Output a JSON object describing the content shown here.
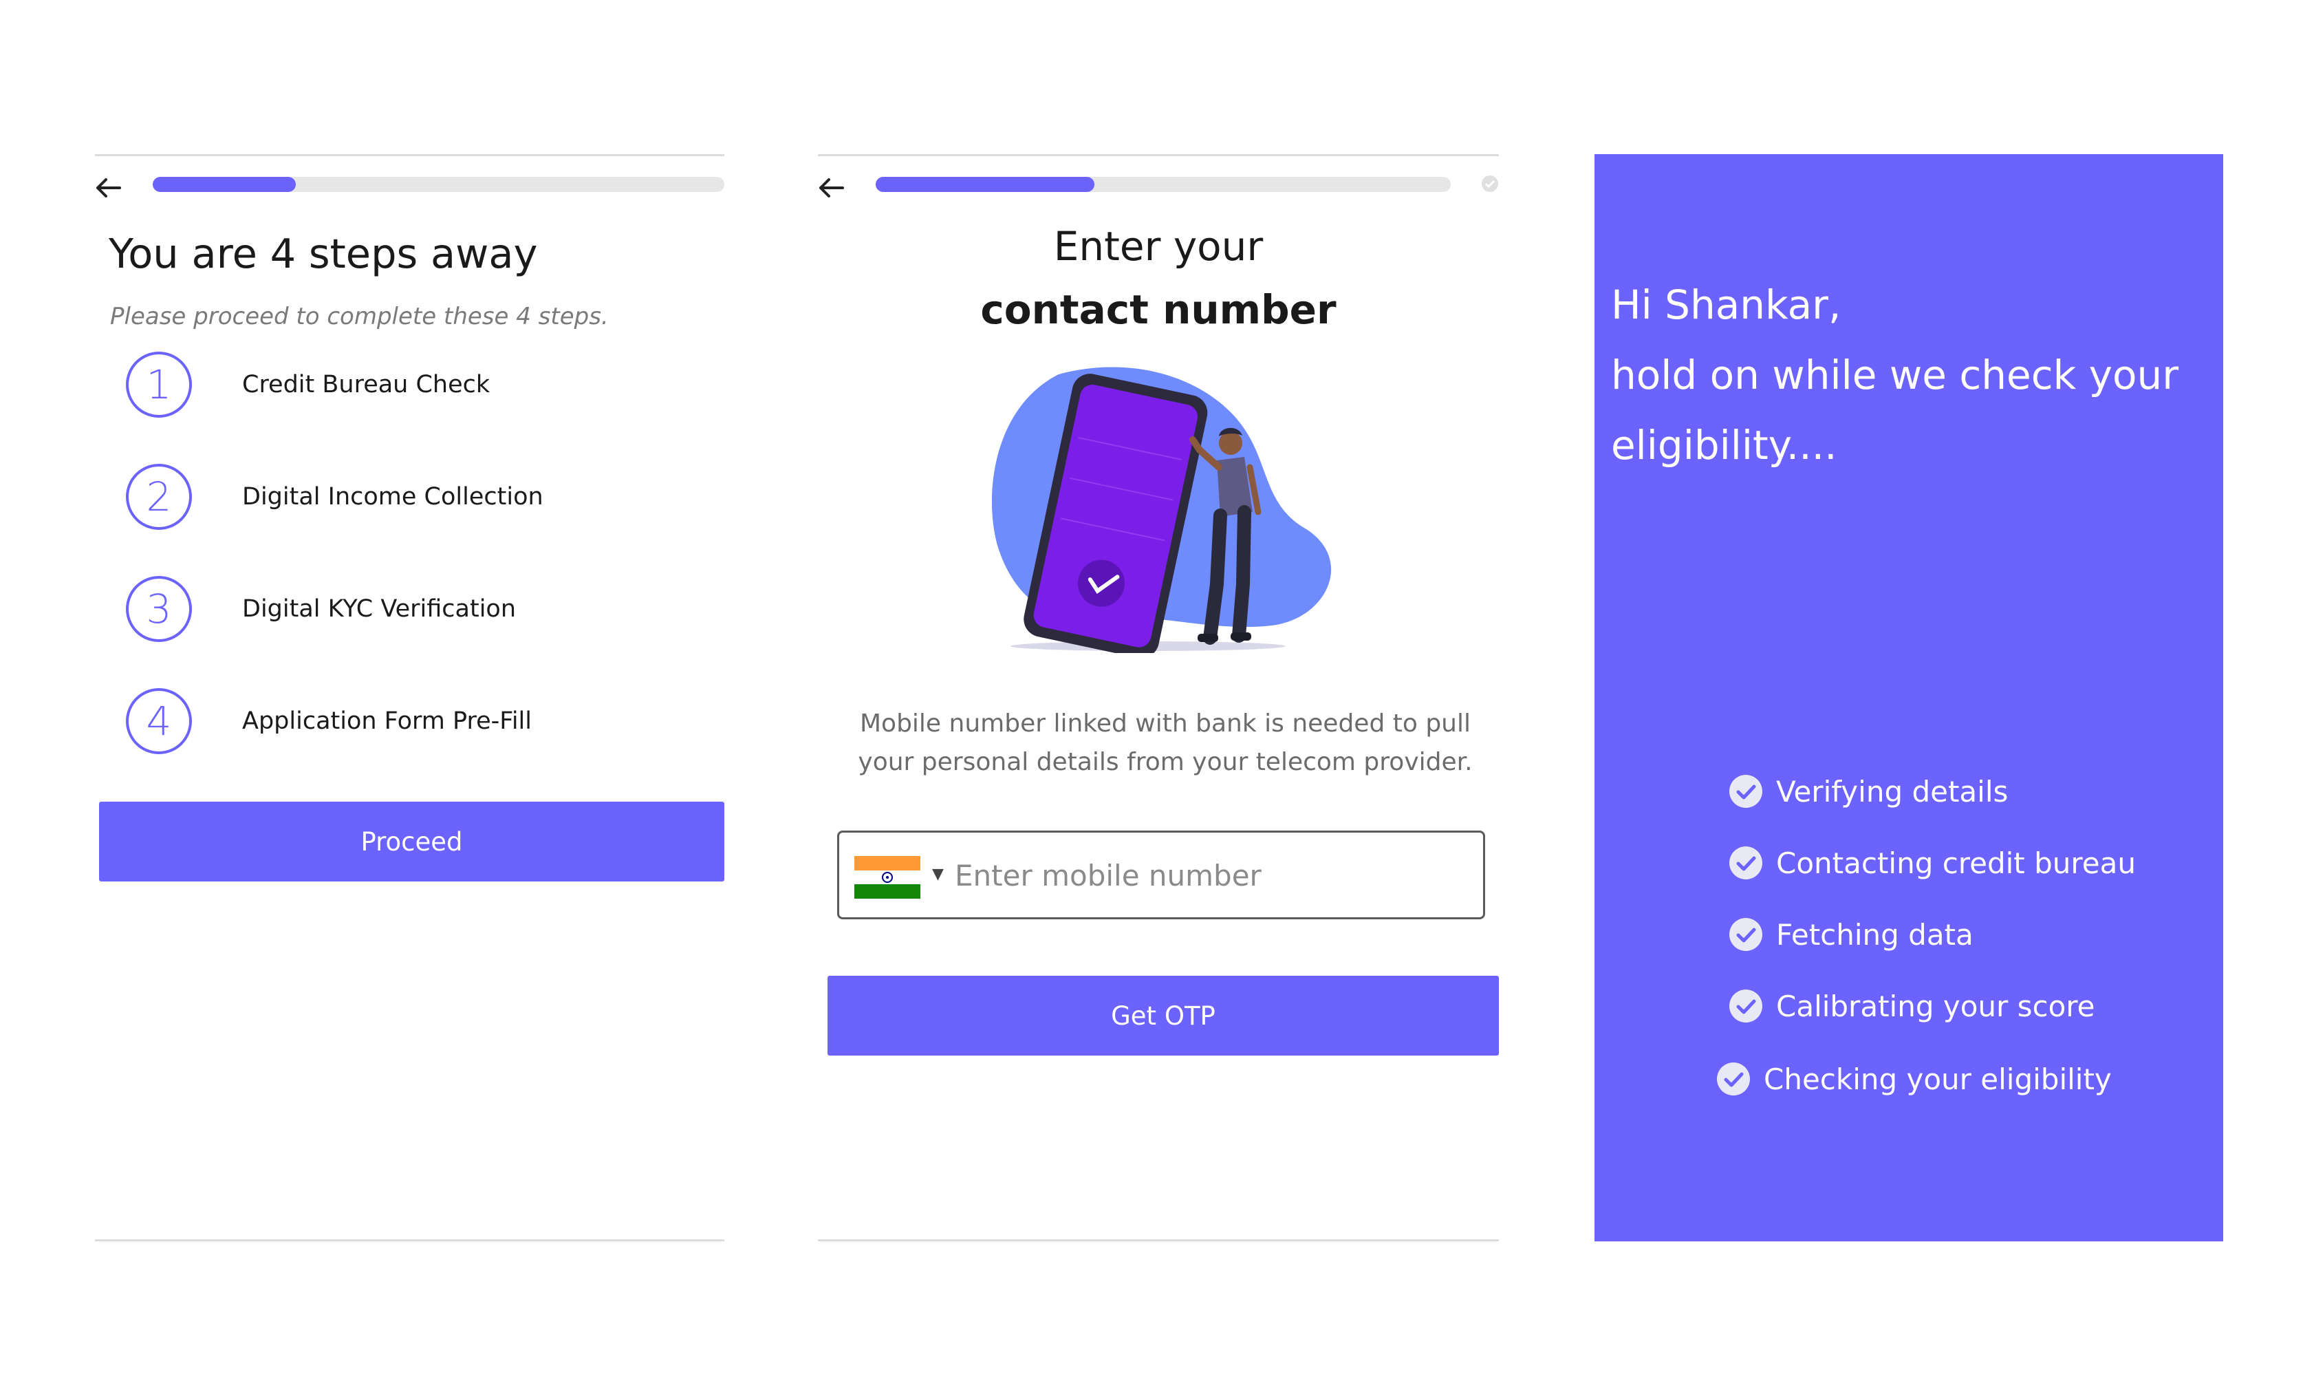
{
  "screen1": {
    "progress": 0.25,
    "title": "You are 4 steps away",
    "subtitle": "Please proceed to complete these 4 steps.",
    "steps": [
      {
        "number": "1",
        "label": "Credit Bureau Check"
      },
      {
        "number": "2",
        "label": "Digital Income Collection"
      },
      {
        "number": "3",
        "label": "Digital KYC Verification"
      },
      {
        "number": "4",
        "label": "Application Form Pre-Fill"
      }
    ],
    "proceed_label": "Proceed"
  },
  "screen2": {
    "progress": 0.38,
    "title_line1": "Enter your",
    "title_line2": "contact number",
    "description": "Mobile number linked with bank is needed to pull your personal details from your telecom provider.",
    "country_flag": "india-flag-icon",
    "phone_placeholder": "Enter mobile number",
    "phone_value": "",
    "get_otp_label": "Get OTP"
  },
  "screen3": {
    "greeting": "Hi Shankar,",
    "message": "hold on while we check your eligibility....",
    "checklist": [
      {
        "label": "Verifying details",
        "icon": "check-circle-icon"
      },
      {
        "label": "Contacting credit bureau",
        "icon": "check-circle-icon"
      },
      {
        "label": "Fetching data",
        "icon": "check-circle-icon"
      },
      {
        "label": "Calibrating your score",
        "icon": "check-circle-icon"
      },
      {
        "label": "Checking your eligibility",
        "icon": "check-circle-icon"
      }
    ]
  },
  "colors": {
    "accent": "#6C63FF",
    "phone_screen": "#7B1FE8",
    "blob": "#6F8CFF"
  }
}
